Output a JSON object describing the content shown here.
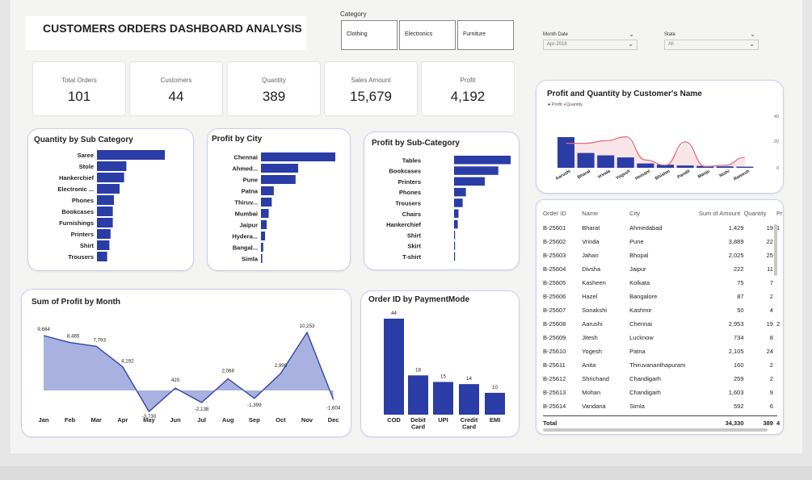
{
  "title": "CUSTOMERS ORDERS DASHBOARD ANALYSIS",
  "category_slicer": {
    "label": "Category",
    "options": [
      "Clothing",
      "Electronics",
      "Furniture"
    ]
  },
  "filters": {
    "month": {
      "label": "Month Date",
      "value": "Apr-2018",
      "icon": "chevron-down-icon"
    },
    "state": {
      "label": "State",
      "value": "All",
      "icon": "chevron-down-icon"
    }
  },
  "kpis": [
    {
      "label": "Total Orders",
      "value": "101"
    },
    {
      "label": "Customers",
      "value": "44"
    },
    {
      "label": "Quantity",
      "value": "389"
    },
    {
      "label": "Sales Amount",
      "value": "15,679"
    },
    {
      "label": "Profit",
      "value": "4,192"
    }
  ],
  "colors": {
    "bar": "#2a3ca6",
    "area": "#9fa8dc",
    "line": "#e06a78",
    "line_fill": "#f7d9dd"
  },
  "chart_data": [
    {
      "id": "qty_subcat",
      "type": "bar",
      "orientation": "horizontal",
      "title": "Quantity by Sub Category",
      "categories": [
        "Saree",
        "Stole",
        "Hankerchief",
        "Electronic ...",
        "Phones",
        "Bookcases",
        "Furnishings",
        "Printers",
        "Shirt",
        "Trousers"
      ],
      "values": [
        60,
        26,
        24,
        20,
        15,
        14,
        14,
        12,
        11,
        9
      ]
    },
    {
      "id": "profit_city",
      "type": "bar",
      "orientation": "horizontal",
      "title": "Profit by City",
      "categories": [
        "Chennai",
        "Ahmed...",
        "Pune",
        "Patna",
        "Thiruv...",
        "Mumbai",
        "Jaipur",
        "Hydera...",
        "Bangal...",
        "Simla"
      ],
      "values": [
        2900,
        1450,
        1350,
        500,
        420,
        300,
        222,
        160,
        87,
        50
      ]
    },
    {
      "id": "profit_subcat",
      "type": "bar",
      "orientation": "horizontal",
      "title": "Profit by Sub-Category",
      "categories": [
        "Tables",
        "Bookcases",
        "Printers",
        "Phones",
        "Trousers",
        "Chairs",
        "Hankerchief",
        "Shirt",
        "Skirt",
        "T-shirt"
      ],
      "values": [
        2300,
        1800,
        1250,
        480,
        350,
        180,
        150,
        40,
        25,
        15
      ]
    },
    {
      "id": "profit_month",
      "type": "area",
      "title": "Sum of Profit by Month",
      "categories": [
        "Jan",
        "Feb",
        "Mar",
        "Apr",
        "May",
        "Jun",
        "Jul",
        "Aug",
        "Sep",
        "Oct",
        "Nov",
        "Dec"
      ],
      "values": [
        9684,
        8465,
        7793,
        4192,
        -3730,
        420,
        -2138,
        2068,
        -1399,
        2999,
        10253,
        -1604
      ],
      "labels": [
        "9,684",
        "8,465",
        "7,793",
        "4,192",
        "-3,730",
        "420",
        "-2,138",
        "2,068",
        "-1,399",
        "2,999",
        "10,253",
        "-1,604"
      ],
      "ylim": [
        -5000,
        12000
      ]
    },
    {
      "id": "orders_payment",
      "type": "bar",
      "title": "Order ID by PaymentMode",
      "categories": [
        "COD",
        "Debit Card",
        "UPI",
        "Credit Card",
        "EMI"
      ],
      "values": [
        44,
        18,
        15,
        14,
        10
      ]
    },
    {
      "id": "profit_qty_customer",
      "type": "bar+line",
      "title": "Profit and Quantity by Customer's Name",
      "legend": [
        "Profit",
        "Quantity"
      ],
      "categories": [
        "Aarushi",
        "Bharat",
        "Vrinda",
        "Yogesh",
        "Hemant",
        "Bhishm",
        "Pandit",
        "Manju",
        "Nishi",
        "Ramesh"
      ],
      "series": [
        {
          "name": "Profit",
          "values": [
            2953,
            1429,
            1200,
            1000,
            420,
            300,
            222,
            180,
            140,
            110
          ]
        },
        {
          "name": "Quantity",
          "values": [
            19,
            19,
            21,
            24,
            6,
            2,
            20,
            1,
            2,
            8
          ]
        }
      ],
      "y2_ticks": [
        "40",
        "20",
        "0"
      ]
    }
  ],
  "orders_table": {
    "columns": [
      "Order ID",
      "Name",
      "City",
      "Sum of Amount",
      "Quantity",
      "Pr"
    ],
    "rows": [
      [
        "B-25601",
        "Bharat",
        "Ahmedabad",
        "1,429",
        "19",
        "1"
      ],
      [
        "B-25602",
        "Vrinda",
        "Pune",
        "3,889",
        "22",
        ""
      ],
      [
        "B-25603",
        "Jahan",
        "Bhopal",
        "2,025",
        "25",
        ""
      ],
      [
        "B-25604",
        "Divsha",
        "Jaipur",
        "222",
        "11",
        ""
      ],
      [
        "B-25605",
        "Kasheen",
        "Kolkata",
        "75",
        "7",
        ""
      ],
      [
        "B-25606",
        "Hazel",
        "Bangalore",
        "87",
        "2",
        ""
      ],
      [
        "B-25607",
        "Sonakshi",
        "Kashmir",
        "50",
        "4",
        ""
      ],
      [
        "B-25608",
        "Aarushi",
        "Chennai",
        "2,953",
        "19",
        "2"
      ],
      [
        "B-25609",
        "Jitesh",
        "Lucknow",
        "734",
        "8",
        ""
      ],
      [
        "B-25610",
        "Yogesh",
        "Patna",
        "2,105",
        "24",
        ""
      ],
      [
        "B-25611",
        "Anita",
        "Thiruvananthapuram",
        "160",
        "2",
        ""
      ],
      [
        "B-25612",
        "Shrichand",
        "Chandigarh",
        "259",
        "2",
        ""
      ],
      [
        "B-25613",
        "Mohan",
        "Chandigarh",
        "1,603",
        "9",
        ""
      ],
      [
        "B-25614",
        "Vandana",
        "Simla",
        "592",
        "6",
        ""
      ]
    ],
    "total": [
      "Total",
      "",
      "",
      "34,330",
      "389",
      "4"
    ]
  }
}
